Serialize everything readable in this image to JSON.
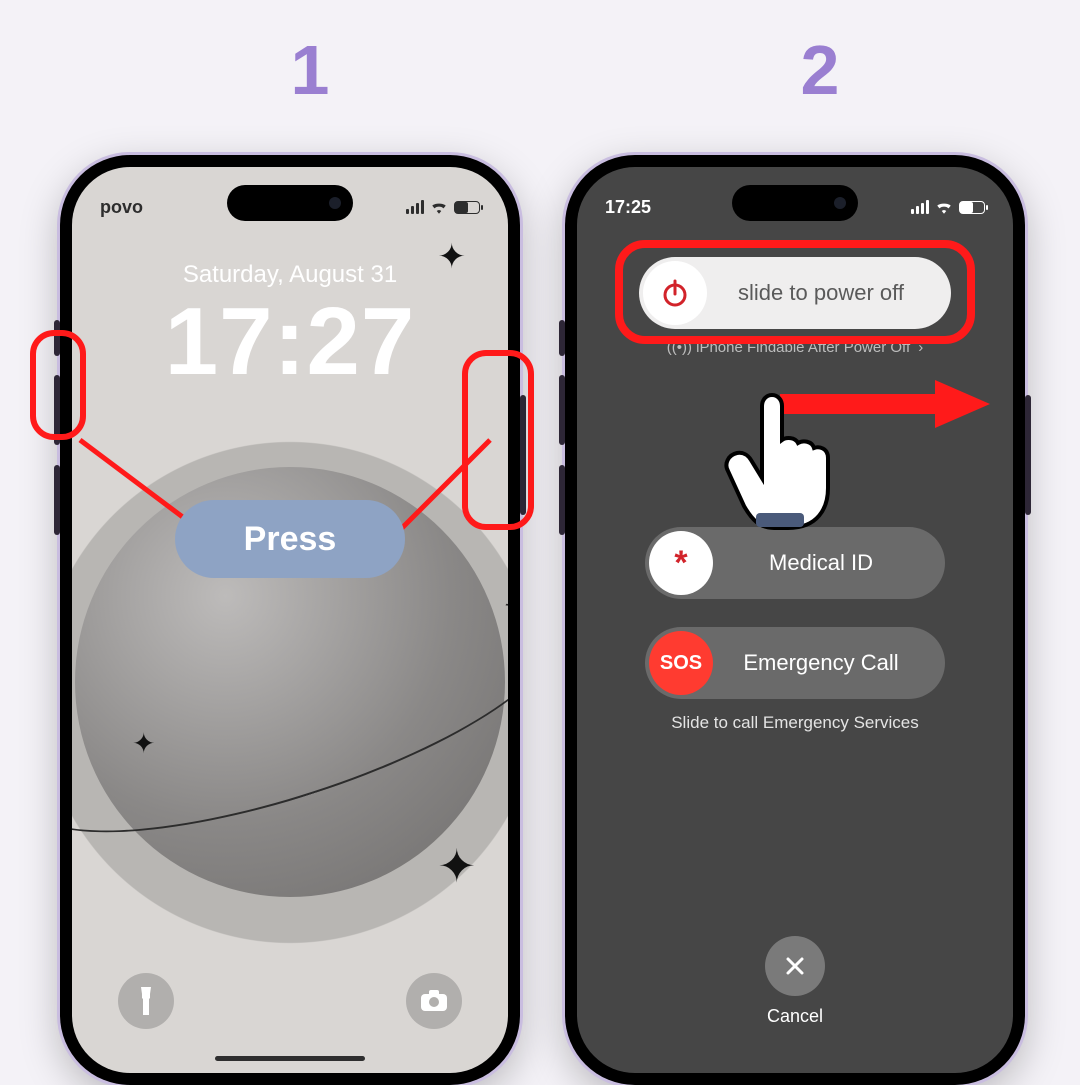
{
  "steps": {
    "one": "1",
    "two": "2"
  },
  "annotations": {
    "press_label": "Press"
  },
  "phone1": {
    "carrier": "povo",
    "date": "Saturday, August 31",
    "time": "17:27"
  },
  "phone2": {
    "status_time": "17:25",
    "power_off_label": "slide to power off",
    "findable_text": "iPhone Findable After Power Off",
    "medical_label": "Medical ID",
    "medical_knob": "*",
    "sos_label": "Emergency Call",
    "sos_knob": "SOS",
    "sos_hint": "Slide to call Emergency Services",
    "cancel_label": "Cancel"
  },
  "colors": {
    "accent_purple": "#9a7fd1",
    "annotation_red": "#ff1a1a",
    "press_pill": "#8ea3c4",
    "sos_red": "#ff3b30"
  }
}
